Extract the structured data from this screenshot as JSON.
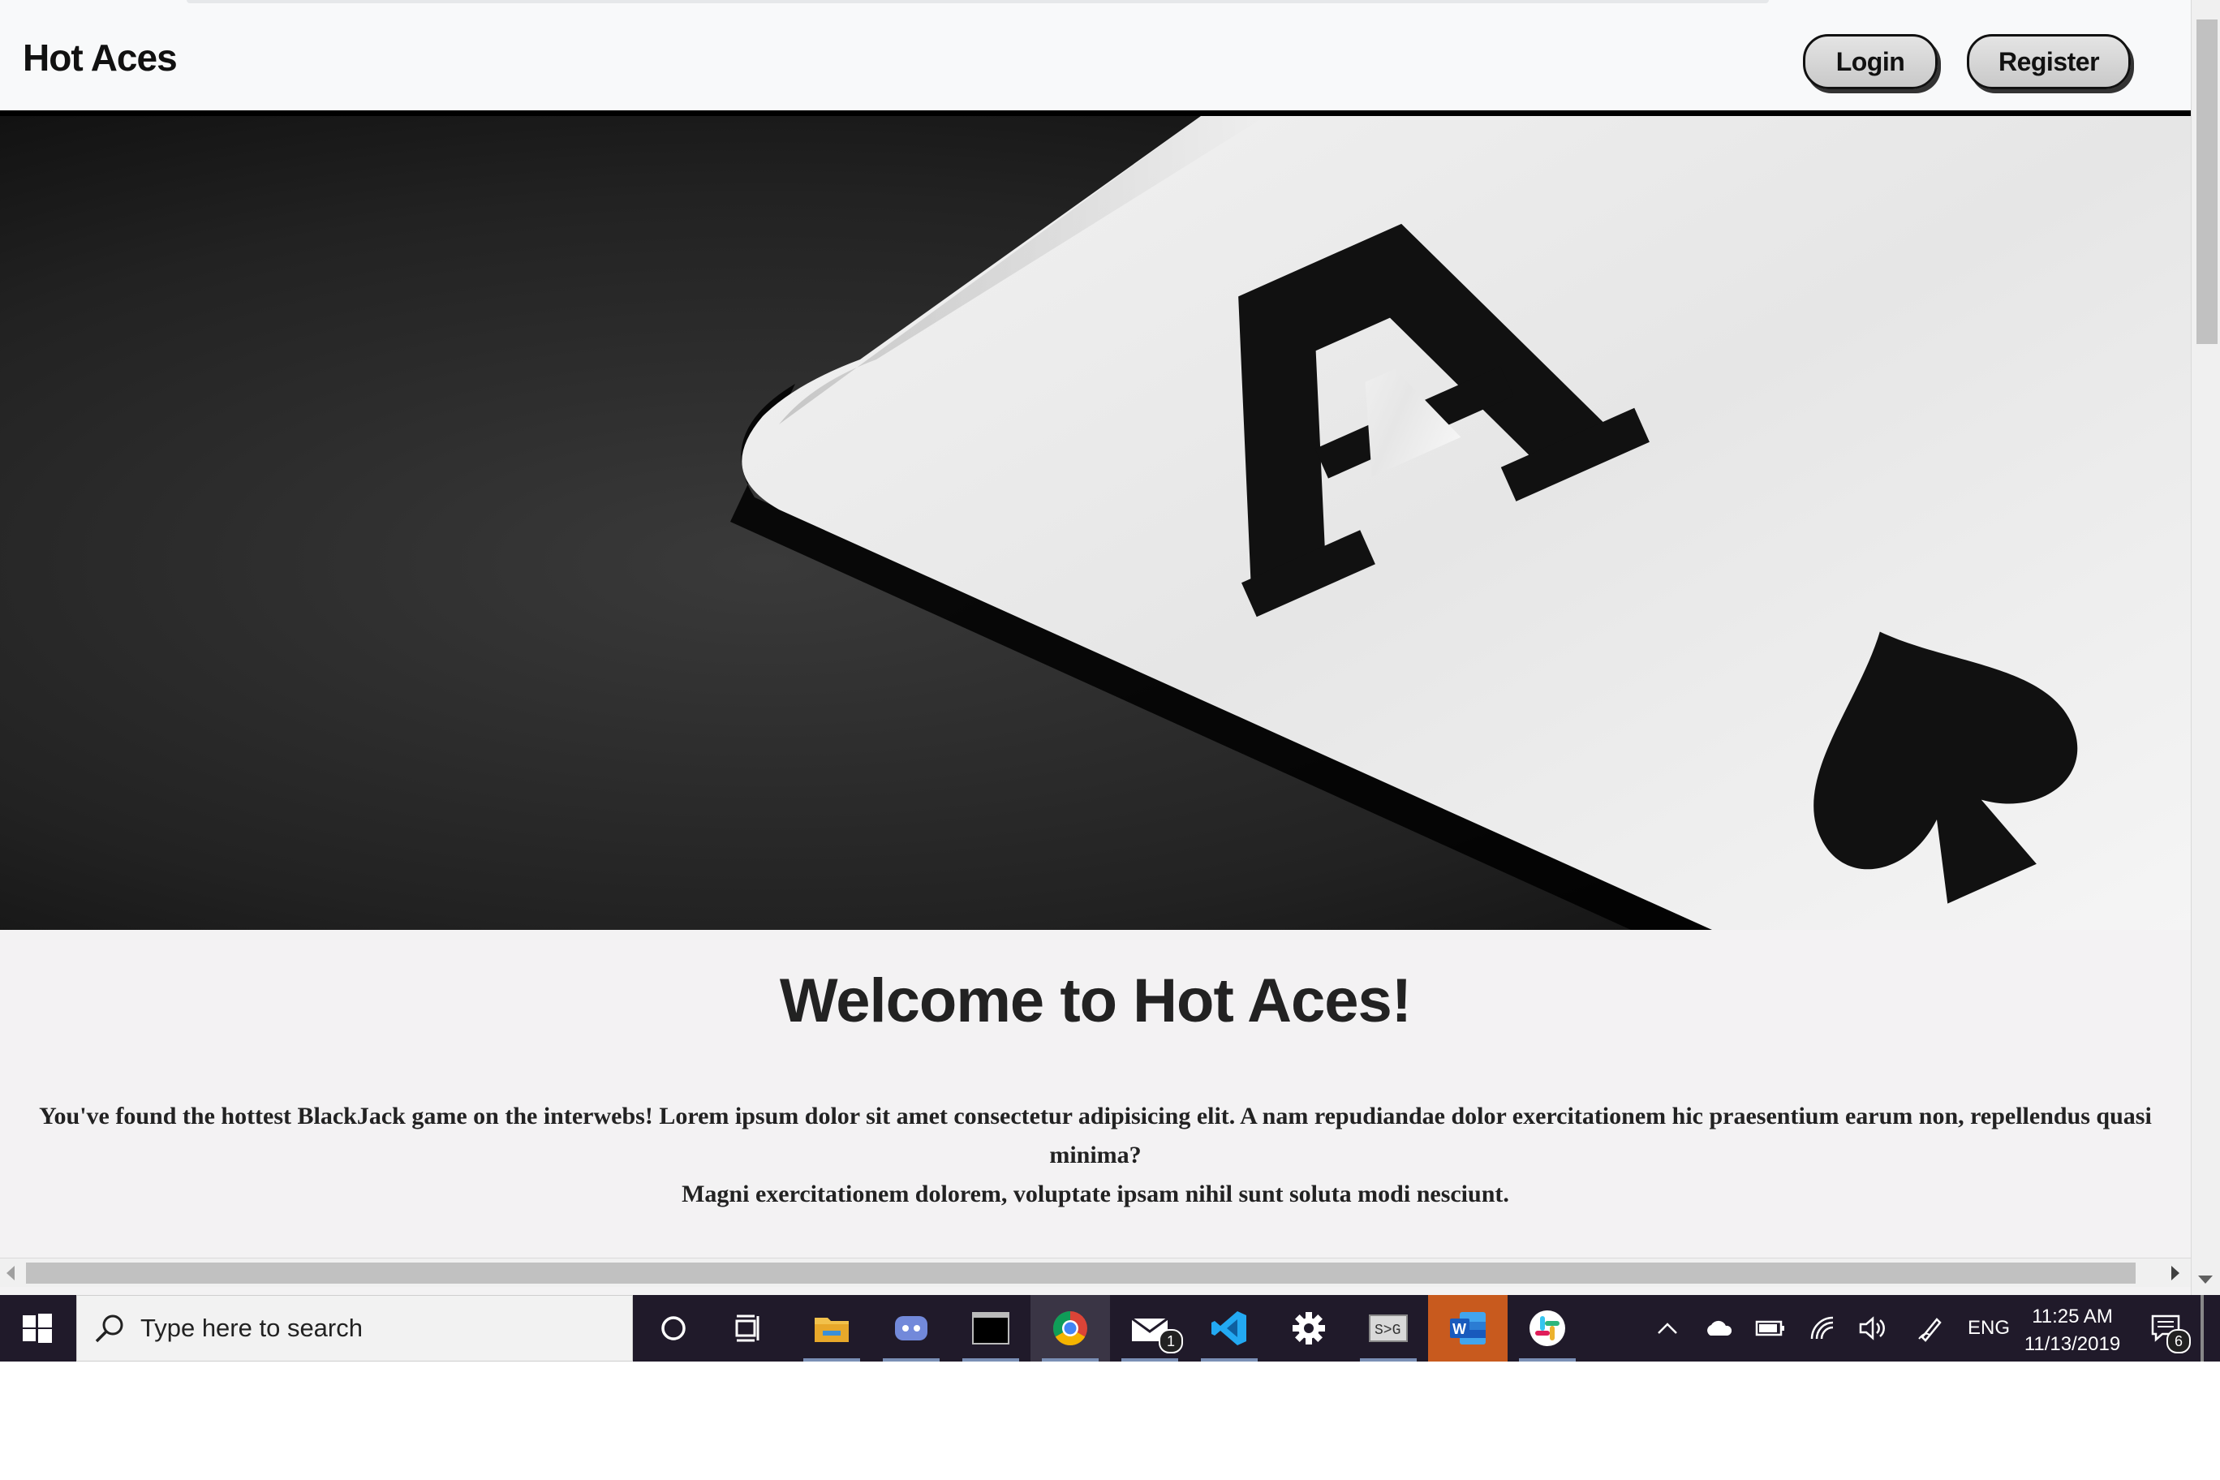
{
  "site": {
    "brand": "Hot Aces",
    "nav": {
      "login_label": "Login",
      "register_label": "Register"
    },
    "hero": {
      "image": "ace-of-spades-card-photo"
    },
    "welcome_title": "Welcome to Hot Aces!",
    "intro_line1": "You've found the hottest BlackJack game on the interwebs! Lorem ipsum dolor sit amet consectetur adipisicing elit. A nam repudiandae dolor exercitationem hic praesentium earum non, repellendus quasi minima?",
    "intro_line2": "Magni exercitationem dolorem, voluptate ipsam nihil sunt soluta modi nesciunt."
  },
  "taskbar": {
    "search_placeholder": "Type here to search",
    "apps": [
      "cortana-icon",
      "task-view-icon",
      "file-explorer-icon",
      "discord-icon",
      "terminal-icon",
      "chrome-icon",
      "mail-icon",
      "vscode-icon",
      "settings-icon",
      "snipping-tool-icon",
      "word-icon",
      "slack-icon"
    ],
    "mail_badge": "1",
    "language": "ENG",
    "time": "11:25 AM",
    "date": "11/13/2019",
    "notification_count": "6"
  },
  "colors": {
    "navbar_bg": "#f8f9fa",
    "page_bg": "#f3f2f3",
    "taskbar_bg": "#201a2a",
    "word_accent": "#c85a1e"
  }
}
